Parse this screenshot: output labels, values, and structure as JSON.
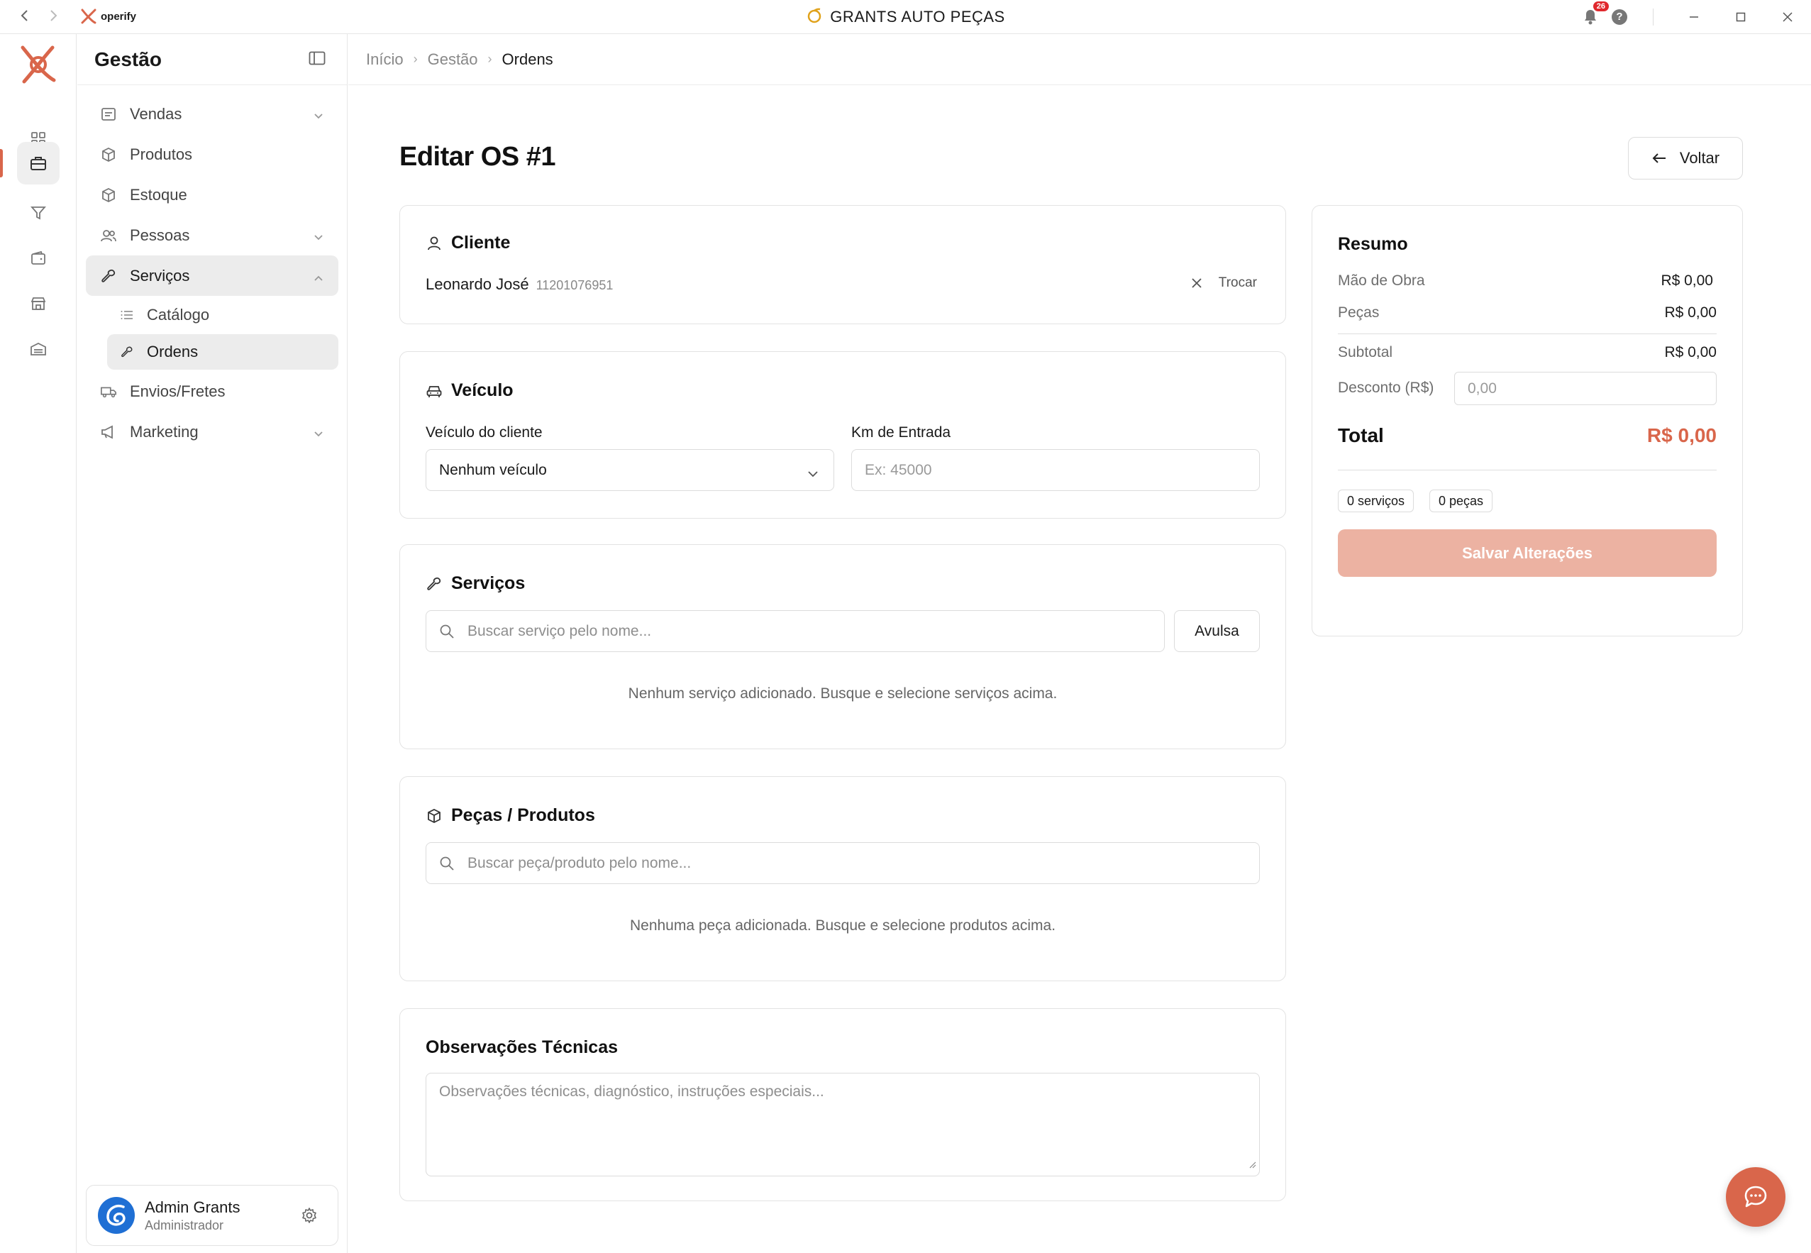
{
  "window": {
    "title": "GRANTS AUTO PEÇAS",
    "logo_text": "operify",
    "notification_count": "26",
    "help_glyph": "?"
  },
  "sidebar": {
    "title": "Gestão",
    "items": [
      {
        "label": "Vendas",
        "icon": "receipt-icon",
        "expandable": true
      },
      {
        "label": "Produtos",
        "icon": "box-icon"
      },
      {
        "label": "Estoque",
        "icon": "box-icon"
      },
      {
        "label": "Pessoas",
        "icon": "users-icon",
        "expandable": true
      },
      {
        "label": "Serviços",
        "icon": "wrench-icon",
        "expanded": true,
        "selected": true,
        "children": [
          {
            "label": "Catálogo",
            "icon": "list-icon"
          },
          {
            "label": "Ordens",
            "icon": "wrench-icon",
            "selected": true
          }
        ]
      },
      {
        "label": "Envios/Fretes",
        "icon": "truck-icon"
      },
      {
        "label": "Marketing",
        "icon": "megaphone-icon",
        "expandable": true
      }
    ],
    "user": {
      "name": "Admin Grants",
      "role": "Administrador"
    }
  },
  "breadcrumb": [
    "Início",
    "Gestão",
    "Ordens"
  ],
  "page": {
    "title": "Editar OS #1",
    "back_label": "Voltar"
  },
  "cliente": {
    "title": "Cliente",
    "name": "Leonardo José",
    "phone": "11201076951",
    "change_label": "Trocar"
  },
  "veiculo": {
    "title": "Veículo",
    "vehicle_label": "Veículo do cliente",
    "vehicle_value": "Nenhum veículo",
    "km_label": "Km de Entrada",
    "km_placeholder": "Ex: 45000"
  },
  "servicos": {
    "title": "Serviços",
    "search_placeholder": "Buscar serviço pelo nome...",
    "avulsa_label": "Avulsa",
    "empty_message": "Nenhum serviço adicionado. Busque e selecione serviços acima."
  },
  "pecas": {
    "title": "Peças / Produtos",
    "search_placeholder": "Buscar peça/produto pelo nome...",
    "empty_message": "Nenhuma peça adicionada. Busque e selecione produtos acima."
  },
  "observacoes": {
    "title": "Observações Técnicas",
    "placeholder": "Observações técnicas, diagnóstico, instruções especiais..."
  },
  "resumo": {
    "title": "Resumo",
    "mao_de_obra_label": "Mão de Obra",
    "mao_de_obra_value": "R$ 0,00",
    "pecas_label": "Peças",
    "pecas_value": "R$ 0,00",
    "subtotal_label": "Subtotal",
    "subtotal_value": "R$ 0,00",
    "desconto_label": "Desconto (R$)",
    "desconto_placeholder": "0,00",
    "total_label": "Total",
    "total_value": "R$ 0,00",
    "servicos_count": "0 serviços",
    "pecas_count": "0 peças",
    "save_label": "Salvar Alterações"
  },
  "colors": {
    "accent": "#d9664b",
    "accent_disabled": "#ecb2a2",
    "notification_badge": "#e0282d",
    "avatar_bg": "#1f6fd4"
  }
}
